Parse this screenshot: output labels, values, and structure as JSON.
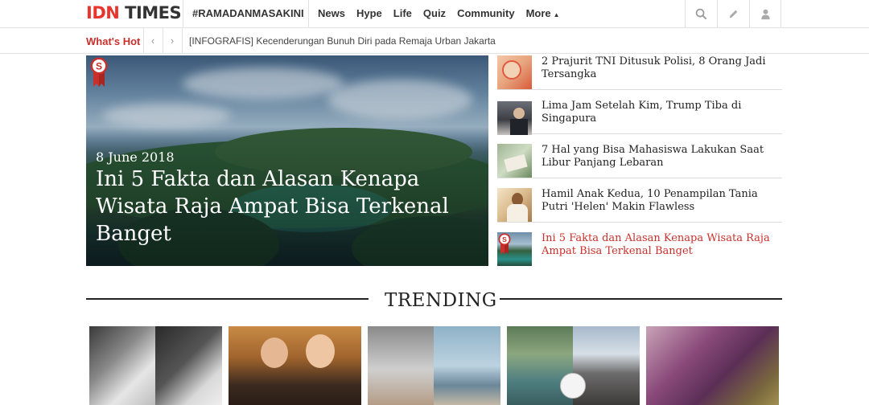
{
  "header": {
    "logo_part1": "IDN",
    "logo_part2": "TIMES",
    "hashtag": "#RAMADANMASAKINI",
    "nav": [
      "News",
      "Hype",
      "Life",
      "Quiz",
      "Community",
      "More"
    ],
    "icons": [
      "search-icon",
      "pencil-icon",
      "user-icon"
    ]
  },
  "hotbar": {
    "label": "What's Hot",
    "headline": "[INFOGRAFIS] Kecenderungan Bunuh Diri pada Remaja Urban Jakarta"
  },
  "hero": {
    "badge_letter": "S",
    "date": "8 June 2018",
    "title": "Ini 5 Fakta dan Alasan Kenapa Wisata Raja Ampat Bisa Terkenal Banget"
  },
  "side_list": [
    {
      "title": "2 Prajurit TNI Ditusuk Polisi, 8 Orang Jadi Tersangka",
      "active": false
    },
    {
      "title": "Lima Jam Setelah Kim, Trump Tiba di Singapura",
      "active": false
    },
    {
      "title": "7 Hal yang Bisa Mahasiswa Lakukan Saat Libur Panjang Lebaran",
      "active": false
    },
    {
      "title": "Hamil Anak Kedua, 10 Penampilan Tania Putri 'Helen' Makin Flawless",
      "active": false
    },
    {
      "title": "Ini 5 Fakta dan Alasan Kenapa Wisata Raja Ampat Bisa Terkenal Banget",
      "active": true
    }
  ],
  "trending": {
    "title": "TRENDING"
  },
  "colors": {
    "brand_red": "#e8342c",
    "hot_red": "#c9302c",
    "text_dark": "#222222"
  }
}
